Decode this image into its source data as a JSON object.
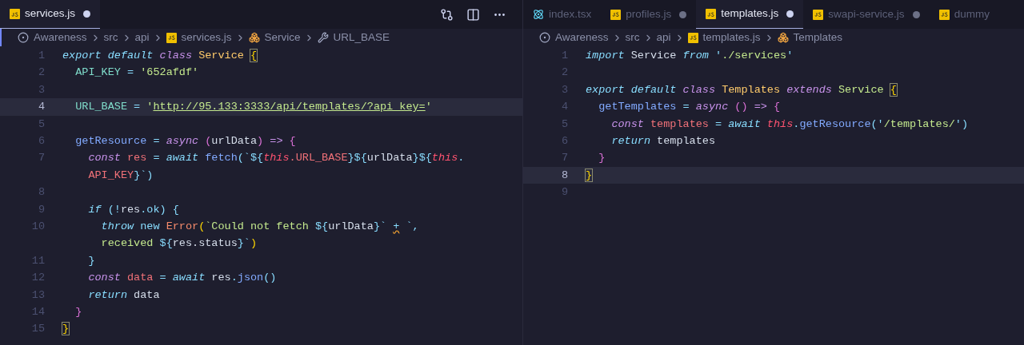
{
  "panes": [
    {
      "tabs": [
        {
          "label": "services.js",
          "kind": "js",
          "selected": true,
          "modified": true
        }
      ],
      "actions": true,
      "breadcrumb": [
        {
          "label": "Awareness",
          "kind": "root"
        },
        {
          "label": "src",
          "kind": "folder"
        },
        {
          "label": "api",
          "kind": "folder"
        },
        {
          "label": "services.js",
          "kind": "js"
        },
        {
          "label": "Service",
          "kind": "class"
        },
        {
          "label": "URL_BASE",
          "kind": "property"
        }
      ],
      "lines": [
        {
          "number": "1",
          "current": false,
          "tokens": [
            {
              "t": "export default",
              "kind": "kw"
            },
            {
              "t": " class",
              "kind": "storage"
            },
            {
              "t": " Service ",
              "kind": "type"
            },
            {
              "t": "{",
              "kind": "brace1",
              "match": true
            }
          ]
        },
        {
          "number": "2",
          "current": false,
          "tokens": [
            {
              "t": "  API_KEY",
              "kind": "prop"
            },
            {
              "t": " = ",
              "kind": "punct"
            },
            {
              "t": "'652afdf'",
              "kind": "str"
            }
          ]
        },
        {
          "number": "3",
          "current": false
        },
        {
          "number": "4",
          "current": true,
          "tokens": [
            {
              "t": "  URL_BASE",
              "kind": "prop"
            },
            {
              "t": " = ",
              "kind": "punct"
            },
            {
              "t": "'",
              "kind": "str"
            },
            {
              "t": "http://95.133:3333/api/templates/?api_key=",
              "kind": "link"
            },
            {
              "t": "'",
              "kind": "str"
            }
          ]
        },
        {
          "number": "5",
          "current": false
        },
        {
          "number": "6",
          "current": false,
          "tokens": [
            {
              "t": "  getResource",
              "kind": "fn"
            },
            {
              "t": " = ",
              "kind": "punct"
            },
            {
              "t": "async",
              "kind": "storage"
            },
            {
              "t": " (",
              "kind": "brace2"
            },
            {
              "t": "urlData",
              "kind": "plain"
            },
            {
              "t": ")",
              "kind": "brace2"
            },
            {
              "t": " => ",
              "kind": "storage"
            },
            {
              "t": "{",
              "kind": "brace2"
            }
          ]
        },
        {
          "number": "7",
          "current": false,
          "tokens": [
            {
              "t": "    const",
              "kind": "storage"
            },
            {
              "t": " res",
              "kind": "var"
            },
            {
              "t": " = ",
              "kind": "punct"
            },
            {
              "t": "await",
              "kind": "kw"
            },
            {
              "t": " fetch",
              "kind": "fn"
            },
            {
              "t": "(`${",
              "kind": "punct"
            },
            {
              "t": "this",
              "kind": "this"
            },
            {
              "t": ".URL_BASE",
              "kind": "var"
            },
            {
              "t": "}${",
              "kind": "punct"
            },
            {
              "t": "urlData",
              "kind": "plain"
            },
            {
              "t": "}${",
              "kind": "punct"
            },
            {
              "t": "this",
              "kind": "this"
            },
            {
              "t": ".",
              "kind": "punct"
            },
            {
              "t": "    API_KEY",
              "kind": "var",
              "wrap_before": true
            },
            {
              "t": "}`)",
              "kind": "punct"
            }
          ]
        },
        {
          "number": "8",
          "current": false
        },
        {
          "number": "9",
          "current": false,
          "tokens": [
            {
              "t": "    if",
              "kind": "kw"
            },
            {
              "t": " (!",
              "kind": "punct"
            },
            {
              "t": "res",
              "kind": "plain"
            },
            {
              "t": ".ok) {",
              "kind": "punct"
            }
          ]
        },
        {
          "number": "10",
          "current": false,
          "tokens": [
            {
              "t": "      throw",
              "kind": "kw"
            },
            {
              "t": " new",
              "kind": "punct"
            },
            {
              "t": " Error",
              "kind": "type2"
            },
            {
              "t": "(",
              "kind": "brace1"
            },
            {
              "t": "`Could not fetch ",
              "kind": "str"
            },
            {
              "t": "${",
              "kind": "punct"
            },
            {
              "t": "urlData",
              "kind": "plain"
            },
            {
              "t": "}` ",
              "kind": "punct"
            },
            {
              "t": "+",
              "kind": "punct",
              "squiggle": true
            },
            {
              "t": " `,",
              "kind": "punct"
            },
            {
              "t": "      received ",
              "kind": "str",
              "wrap_before": true
            },
            {
              "t": "${",
              "kind": "punct"
            },
            {
              "t": "res.status",
              "kind": "plain"
            },
            {
              "t": "}`",
              "kind": "punct"
            },
            {
              "t": ")",
              "kind": "brace1"
            }
          ]
        },
        {
          "number": "11",
          "current": false,
          "tokens": [
            {
              "t": "    }",
              "kind": "punct"
            }
          ]
        },
        {
          "number": "12",
          "current": false,
          "tokens": [
            {
              "t": "    const",
              "kind": "storage"
            },
            {
              "t": " data",
              "kind": "var"
            },
            {
              "t": " = ",
              "kind": "punct"
            },
            {
              "t": "await",
              "kind": "kw"
            },
            {
              "t": " res",
              "kind": "plain"
            },
            {
              "t": ".",
              "kind": "punct"
            },
            {
              "t": "json",
              "kind": "fn"
            },
            {
              "t": "()",
              "kind": "punct"
            }
          ]
        },
        {
          "number": "13",
          "current": false,
          "tokens": [
            {
              "t": "    return",
              "kind": "kw"
            },
            {
              "t": " data",
              "kind": "plain"
            }
          ]
        },
        {
          "number": "14",
          "current": false,
          "tokens": [
            {
              "t": "  }",
              "kind": "brace2"
            }
          ]
        },
        {
          "number": "15",
          "current": false,
          "tokens": [
            {
              "t": "}",
              "kind": "brace1",
              "match": true
            }
          ]
        }
      ]
    },
    {
      "tabs": [
        {
          "label": "index.tsx",
          "kind": "react",
          "selected": false,
          "modified": false
        },
        {
          "label": "profiles.js",
          "kind": "js",
          "selected": false,
          "modified": true
        },
        {
          "label": "templates.js",
          "kind": "js",
          "selected": true,
          "modified": true
        },
        {
          "label": "swapi-service.js",
          "kind": "js",
          "selected": false,
          "modified": true
        },
        {
          "label": "dummy",
          "kind": "js",
          "selected": false,
          "modified": false
        }
      ],
      "actions": false,
      "breadcrumb": [
        {
          "label": "Awareness",
          "kind": "root"
        },
        {
          "label": "src",
          "kind": "folder"
        },
        {
          "label": "api",
          "kind": "folder"
        },
        {
          "label": "templates.js",
          "kind": "js"
        },
        {
          "label": "Templates",
          "kind": "class"
        }
      ],
      "lines": [
        {
          "number": "1",
          "current": false,
          "tokens": [
            {
              "t": "import",
              "kind": "kw"
            },
            {
              "t": " Service ",
              "kind": "plain"
            },
            {
              "t": "from",
              "kind": "kw"
            },
            {
              "t": " '",
              "kind": "punct"
            },
            {
              "t": "./services",
              "kind": "str"
            },
            {
              "t": "'",
              "kind": "punct"
            }
          ]
        },
        {
          "number": "2",
          "current": false
        },
        {
          "number": "3",
          "current": false,
          "tokens": [
            {
              "t": "export default",
              "kind": "kw"
            },
            {
              "t": " class",
              "kind": "storage"
            },
            {
              "t": " Templates",
              "kind": "type"
            },
            {
              "t": " extends",
              "kind": "storage"
            },
            {
              "t": " Service ",
              "kind": "str"
            },
            {
              "t": "{",
              "kind": "brace1",
              "match": true
            }
          ]
        },
        {
          "number": "4",
          "current": false,
          "tokens": [
            {
              "t": "  getTemplates",
              "kind": "fn"
            },
            {
              "t": " = ",
              "kind": "punct"
            },
            {
              "t": "async",
              "kind": "storage"
            },
            {
              "t": " ()",
              "kind": "brace2"
            },
            {
              "t": " => ",
              "kind": "storage"
            },
            {
              "t": "{",
              "kind": "brace2"
            }
          ]
        },
        {
          "number": "5",
          "current": false,
          "tokens": [
            {
              "t": "    const",
              "kind": "storage"
            },
            {
              "t": " templates",
              "kind": "var"
            },
            {
              "t": " = ",
              "kind": "punct"
            },
            {
              "t": "await",
              "kind": "kw"
            },
            {
              "t": " this",
              "kind": "this"
            },
            {
              "t": ".",
              "kind": "punct"
            },
            {
              "t": "getResource",
              "kind": "fn"
            },
            {
              "t": "('",
              "kind": "punct"
            },
            {
              "t": "/templates/",
              "kind": "str"
            },
            {
              "t": "')",
              "kind": "punct"
            }
          ]
        },
        {
          "number": "6",
          "current": false,
          "tokens": [
            {
              "t": "    return",
              "kind": "kw"
            },
            {
              "t": " templates",
              "kind": "plain"
            }
          ]
        },
        {
          "number": "7",
          "current": false,
          "tokens": [
            {
              "t": "  }",
              "kind": "brace2"
            }
          ]
        },
        {
          "number": "8",
          "current": true,
          "tokens": [
            {
              "t": "}",
              "kind": "brace1",
              "match": true
            }
          ]
        },
        {
          "number": "9",
          "current": false
        }
      ]
    }
  ]
}
